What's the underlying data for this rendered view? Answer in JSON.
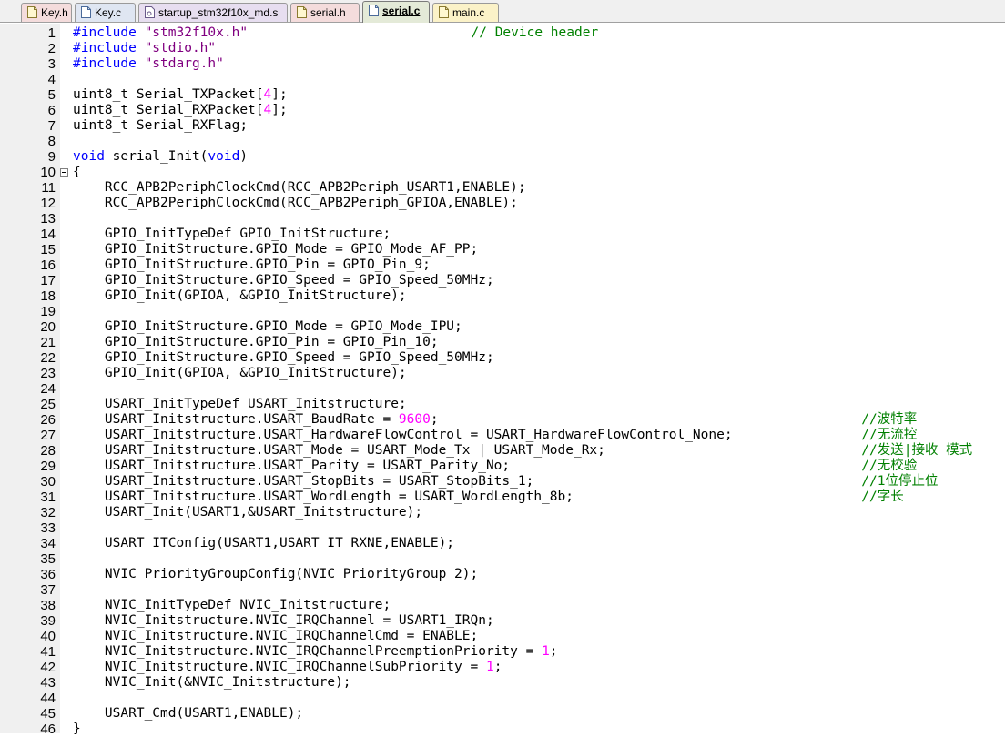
{
  "tabs": [
    {
      "label": "Key.h",
      "kind": "h",
      "active": false
    },
    {
      "label": "Key.c",
      "kind": "c",
      "active": false
    },
    {
      "label": "startup_stm32f10x_md.s",
      "kind": "s",
      "active": false
    },
    {
      "label": "serial.h",
      "kind": "h",
      "active": false
    },
    {
      "label": "serial.c",
      "kind": "c",
      "active": true
    },
    {
      "label": "main.c",
      "kind": "main",
      "active": false
    }
  ],
  "colors": {
    "keyword": "#0000ff",
    "preprocessor": "#0000ff",
    "string": "#800080",
    "number": "#ff00ff",
    "comment": "#008000",
    "plain": "#000000"
  },
  "lines": [
    {
      "n": "1",
      "parts": [
        [
          "pp",
          "#include "
        ],
        [
          "str",
          "\"stm32f10x.h\""
        ]
      ],
      "comment": "// Device header",
      "comment_col": 50
    },
    {
      "n": "2",
      "parts": [
        [
          "pp",
          "#include "
        ],
        [
          "str",
          "\"stdio.h\""
        ]
      ]
    },
    {
      "n": "3",
      "parts": [
        [
          "pp",
          "#include "
        ],
        [
          "str",
          "\"stdarg.h\""
        ]
      ]
    },
    {
      "n": "4",
      "parts": []
    },
    {
      "n": "5",
      "parts": [
        [
          "t",
          "uint8_t Serial_TXPacket["
        ],
        [
          "num",
          "4"
        ],
        [
          "t",
          "];"
        ]
      ]
    },
    {
      "n": "6",
      "parts": [
        [
          "t",
          "uint8_t Serial_RXPacket["
        ],
        [
          "num",
          "4"
        ],
        [
          "t",
          "];"
        ]
      ]
    },
    {
      "n": "7",
      "parts": [
        [
          "t",
          "uint8_t Serial_RXFlag;"
        ]
      ]
    },
    {
      "n": "8",
      "parts": []
    },
    {
      "n": "9",
      "parts": [
        [
          "kw",
          "void"
        ],
        [
          "t",
          " serial_Init("
        ],
        [
          "kw",
          "void"
        ],
        [
          "t",
          ")"
        ]
      ]
    },
    {
      "n": "10",
      "parts": [
        [
          "t",
          "{"
        ]
      ],
      "fold": true
    },
    {
      "n": "11",
      "parts": [
        [
          "t",
          "    RCC_APB2PeriphClockCmd(RCC_APB2Periph_USART1,ENABLE);"
        ]
      ]
    },
    {
      "n": "12",
      "parts": [
        [
          "t",
          "    RCC_APB2PeriphClockCmd(RCC_APB2Periph_GPIOA,ENABLE);"
        ]
      ]
    },
    {
      "n": "13",
      "parts": []
    },
    {
      "n": "14",
      "parts": [
        [
          "t",
          "    GPIO_InitTypeDef GPIO_InitStructure;"
        ]
      ]
    },
    {
      "n": "15",
      "parts": [
        [
          "t",
          "    GPIO_InitStructure.GPIO_Mode = GPIO_Mode_AF_PP;"
        ]
      ]
    },
    {
      "n": "16",
      "parts": [
        [
          "t",
          "    GPIO_InitStructure.GPIO_Pin = GPIO_Pin_9;"
        ]
      ]
    },
    {
      "n": "17",
      "parts": [
        [
          "t",
          "    GPIO_InitStructure.GPIO_Speed = GPIO_Speed_50MHz;"
        ]
      ]
    },
    {
      "n": "18",
      "parts": [
        [
          "t",
          "    GPIO_Init(GPIOA, &GPIO_InitStructure);"
        ]
      ]
    },
    {
      "n": "19",
      "parts": []
    },
    {
      "n": "20",
      "parts": [
        [
          "t",
          "    GPIO_InitStructure.GPIO_Mode = GPIO_Mode_IPU;"
        ]
      ]
    },
    {
      "n": "21",
      "parts": [
        [
          "t",
          "    GPIO_InitStructure.GPIO_Pin = GPIO_Pin_10;"
        ]
      ]
    },
    {
      "n": "22",
      "parts": [
        [
          "t",
          "    GPIO_InitStructure.GPIO_Speed = GPIO_Speed_50MHz;"
        ]
      ]
    },
    {
      "n": "23",
      "parts": [
        [
          "t",
          "    GPIO_Init(GPIOA, &GPIO_InitStructure);"
        ]
      ]
    },
    {
      "n": "24",
      "parts": []
    },
    {
      "n": "25",
      "parts": [
        [
          "t",
          "    USART_InitTypeDef USART_Initstructure;"
        ]
      ]
    },
    {
      "n": "26",
      "parts": [
        [
          "t",
          "    USART_Initstructure.USART_BaudRate = "
        ],
        [
          "num",
          "9600"
        ],
        [
          "t",
          ";"
        ]
      ],
      "comment": "//波特率",
      "comment_col": 99
    },
    {
      "n": "27",
      "parts": [
        [
          "t",
          "    USART_Initstructure.USART_HardwareFlowControl = USART_HardwareFlowControl_None;"
        ]
      ],
      "comment": "//无流控",
      "comment_col": 99
    },
    {
      "n": "28",
      "parts": [
        [
          "t",
          "    USART_Initstructure.USART_Mode = USART_Mode_Tx | USART_Mode_Rx;"
        ]
      ],
      "comment": "//发送|接收 模式",
      "comment_col": 99
    },
    {
      "n": "29",
      "parts": [
        [
          "t",
          "    USART_Initstructure.USART_Parity = USART_Parity_No;"
        ]
      ],
      "comment": "//无校验",
      "comment_col": 99
    },
    {
      "n": "30",
      "parts": [
        [
          "t",
          "    USART_Initstructure.USART_StopBits = USART_StopBits_1;"
        ]
      ],
      "comment": "//1位停止位",
      "comment_col": 99
    },
    {
      "n": "31",
      "parts": [
        [
          "t",
          "    USART_Initstructure.USART_WordLength = USART_WordLength_8b;"
        ]
      ],
      "comment": "//字长",
      "comment_col": 99
    },
    {
      "n": "32",
      "parts": [
        [
          "t",
          "    USART_Init(USART1,&USART_Initstructure);"
        ]
      ]
    },
    {
      "n": "33",
      "parts": []
    },
    {
      "n": "34",
      "parts": [
        [
          "t",
          "    USART_ITConfig(USART1,USART_IT_RXNE,ENABLE);"
        ]
      ]
    },
    {
      "n": "35",
      "parts": []
    },
    {
      "n": "36",
      "parts": [
        [
          "t",
          "    NVIC_PriorityGroupConfig(NVIC_PriorityGroup_2);"
        ]
      ]
    },
    {
      "n": "37",
      "parts": []
    },
    {
      "n": "38",
      "parts": [
        [
          "t",
          "    NVIC_InitTypeDef NVIC_Initstructure;"
        ]
      ]
    },
    {
      "n": "39",
      "parts": [
        [
          "t",
          "    NVIC_Initstructure.NVIC_IRQChannel = USART1_IRQn;"
        ]
      ]
    },
    {
      "n": "40",
      "parts": [
        [
          "t",
          "    NVIC_Initstructure.NVIC_IRQChannelCmd = ENABLE;"
        ]
      ]
    },
    {
      "n": "41",
      "parts": [
        [
          "t",
          "    NVIC_Initstructure.NVIC_IRQChannelPreemptionPriority = "
        ],
        [
          "num",
          "1"
        ],
        [
          "t",
          ";"
        ]
      ]
    },
    {
      "n": "42",
      "parts": [
        [
          "t",
          "    NVIC_Initstructure.NVIC_IRQChannelSubPriority = "
        ],
        [
          "num",
          "1"
        ],
        [
          "t",
          ";"
        ]
      ]
    },
    {
      "n": "43",
      "parts": [
        [
          "t",
          "    NVIC_Init(&NVIC_Initstructure);"
        ]
      ]
    },
    {
      "n": "44",
      "parts": []
    },
    {
      "n": "45",
      "parts": [
        [
          "t",
          "    USART_Cmd(USART1,ENABLE);"
        ]
      ]
    },
    {
      "n": "46",
      "parts": [
        [
          "t",
          "}"
        ]
      ]
    }
  ]
}
